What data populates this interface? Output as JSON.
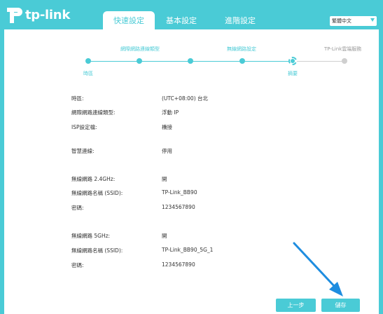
{
  "brand": {
    "name": "tp-link",
    "accent": "#4acbd6"
  },
  "tabs": [
    {
      "label": "快速設定",
      "active": true
    },
    {
      "label": "基本設定",
      "active": false
    },
    {
      "label": "進階設定",
      "active": false
    }
  ],
  "language": {
    "selected": "繁體中文"
  },
  "steps": {
    "labels_top": [
      "網際網路連線類型",
      "無線網路設定",
      "TP-Link雲端服務"
    ],
    "labels_bottom": [
      "時區",
      "摘要"
    ]
  },
  "summary": {
    "timezone": {
      "label": "時區:",
      "value": "(UTC+08:00) 台北"
    },
    "conn_type": {
      "label": "網際網路連線類型:",
      "value": "浮動 IP"
    },
    "isp": {
      "label": "ISP設定檔:",
      "value": "橋接"
    },
    "smart_connect": {
      "label": "智慧連線:",
      "value": "停用"
    },
    "wifi24": {
      "band": {
        "label": "無線網路 2.4GHz:",
        "value": "開"
      },
      "ssid": {
        "label": "無線網路名稱 (SSID):",
        "value": "TP-Link_BB90"
      },
      "password": {
        "label": "密碼:",
        "value": "1234567890"
      }
    },
    "wifi5": {
      "band": {
        "label": "無線網路 5GHz:",
        "value": "開"
      },
      "ssid": {
        "label": "無線網路名稱 (SSID):",
        "value": "TP-Link_BB90_5G_1"
      },
      "password": {
        "label": "密碼:",
        "value": "1234567890"
      }
    }
  },
  "buttons": {
    "prev": "上一步",
    "save": "儲存"
  }
}
